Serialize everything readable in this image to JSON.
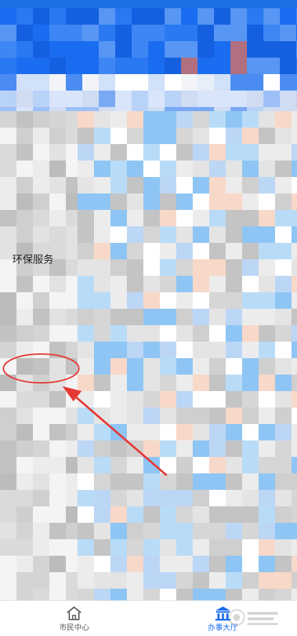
{
  "colors": {
    "brand_blue": "#1a6cf0",
    "annotation_red": "#e53935",
    "nav_inactive": "#555555",
    "nav_active": "#1a6cf0"
  },
  "sidebar": {
    "highlighted_item": {
      "label": "环保服务"
    }
  },
  "bottom_nav": {
    "items": [
      {
        "label": "市民中心",
        "icon": "home-icon",
        "active": false
      },
      {
        "label": "办事大厅",
        "icon": "government-hall-icon",
        "active": true
      }
    ]
  }
}
